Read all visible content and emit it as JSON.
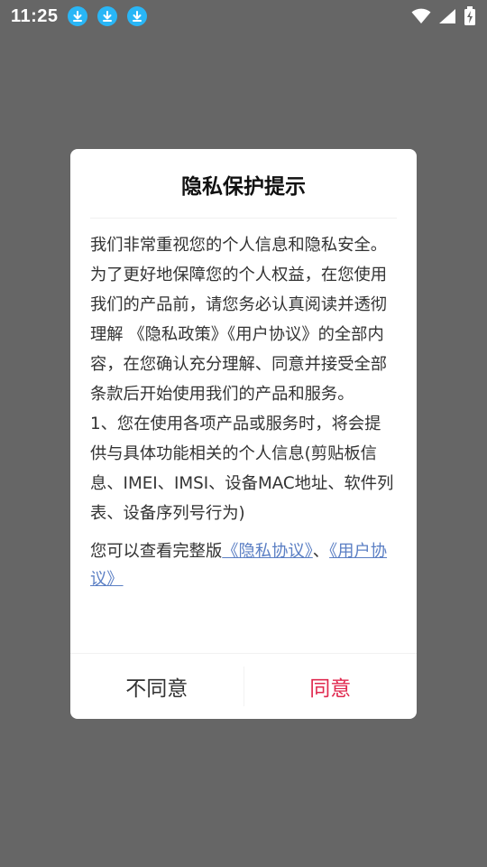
{
  "status_bar": {
    "time": "11:25",
    "notifications": [
      "download-icon",
      "download-icon",
      "download-icon"
    ],
    "accent_color": "#29b6f6"
  },
  "dialog": {
    "title": "隐私保护提示",
    "paragraph1": "我们非常重视您的个人信息和隐私安全。为了更好地保障您的个人权益，在您使用我们的产品前，请您务必认真阅读并透彻理解 《隐私政策》《用户协议》的全部内容，在您确认充分理解、同意并接受全部条款后开始使用我们的产品和服务。",
    "paragraph2": "1、您在使用各项产品或服务时，将会提供与具体功能相关的个人信息(剪贴板信息、IMEI、IMSI、设备MAC地址、软件列表、设备序列号行为)",
    "links_prefix": "您可以查看完整版",
    "link_privacy": "《隐私协议》",
    "links_sep": "、",
    "link_user": "《用户协议》",
    "disagree_label": "不同意",
    "agree_label": "同意",
    "agree_color": "#e0294f",
    "link_color": "#5b7fc4"
  }
}
